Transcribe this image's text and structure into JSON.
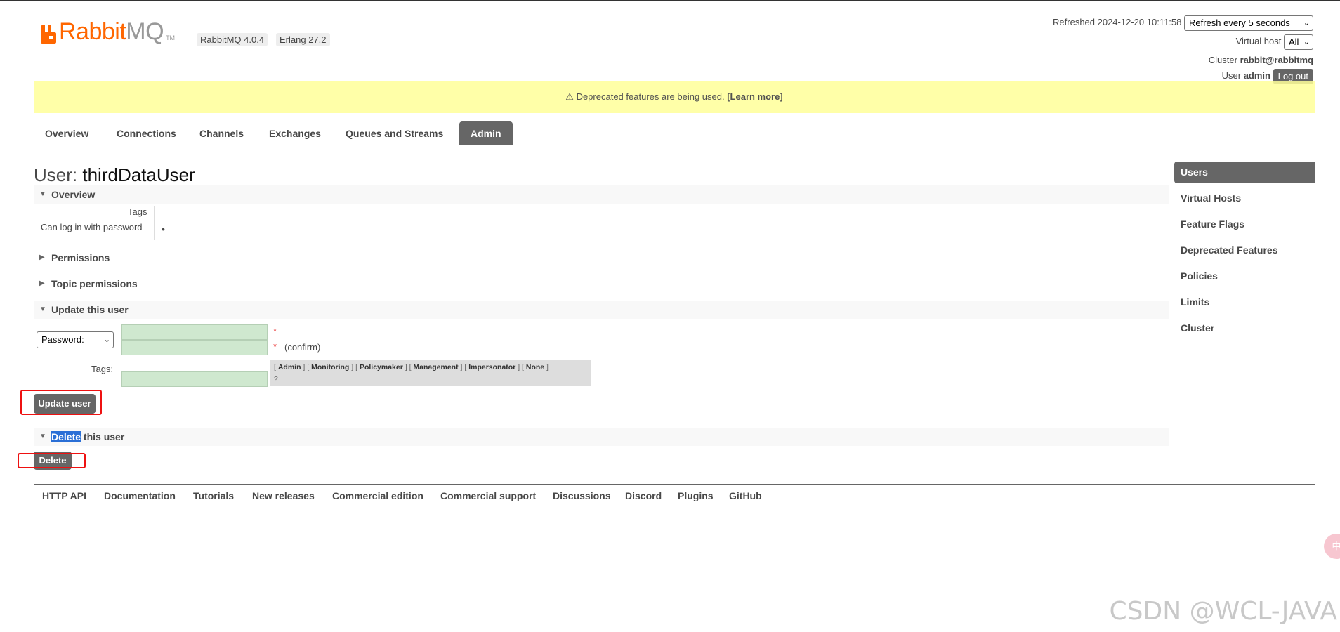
{
  "header": {
    "logo": {
      "text_main": "Rabbit",
      "text_mq": "MQ",
      "tm": "TM"
    },
    "version_badge": "RabbitMQ 4.0.4",
    "erlang_badge": "Erlang 27.2",
    "refreshed_label": "Refreshed 2024-12-20 10:11:58",
    "refresh_select": "Refresh every 5 seconds",
    "vhost_label": "Virtual host",
    "vhost_select": "All",
    "cluster_label": "Cluster",
    "cluster_value": "rabbit@rabbitmq",
    "user_label": "User",
    "user_value": "admin",
    "logout_label": "Log out"
  },
  "warning": {
    "icon": "⚠",
    "text": " Deprecated features are being used. ",
    "link": "[Learn more]"
  },
  "tabs": [
    {
      "label": "Overview"
    },
    {
      "label": "Connections"
    },
    {
      "label": "Channels"
    },
    {
      "label": "Exchanges"
    },
    {
      "label": "Queues and Streams"
    },
    {
      "label": "Admin",
      "active": true
    }
  ],
  "page": {
    "title_prefix": "User:",
    "title_name": "thirdDataUser"
  },
  "overview": {
    "heading": "Overview",
    "tags_label": "Tags",
    "login_label": "Can log in with password",
    "login_value": "•"
  },
  "sections": {
    "permissions": "Permissions",
    "topic_permissions": "Topic permissions",
    "update_user": "Update this user",
    "delete_highlight": "Delete",
    "delete_rest": " this user"
  },
  "update_form": {
    "password_select": "Password:",
    "required_mark": "*",
    "confirm_label": "(confirm)",
    "tags_label": "Tags:",
    "tag_options": [
      "Admin",
      "Monitoring",
      "Policymaker",
      "Management",
      "Impersonator",
      "None"
    ],
    "help_mark": "?",
    "update_button": "Update user"
  },
  "delete_button": "Delete",
  "sidebar": [
    {
      "label": "Users",
      "active": true
    },
    {
      "label": "Virtual Hosts"
    },
    {
      "label": "Feature Flags"
    },
    {
      "label": "Deprecated Features"
    },
    {
      "label": "Policies"
    },
    {
      "label": "Limits"
    },
    {
      "label": "Cluster"
    }
  ],
  "footer": [
    "HTTP API",
    "Documentation",
    "Tutorials",
    "New releases",
    "Commercial edition",
    "Commercial support",
    "Discussions",
    "Discord",
    "Plugins",
    "GitHub"
  ],
  "watermark": "CSDN @WCL-JAVA",
  "float_button": "中",
  "colors": {
    "accent": "#ff6600",
    "tab_active": "#666666",
    "warning_bg": "#ffff99",
    "input_bg": "#cfe8cf",
    "annotation": "#ee1111"
  }
}
